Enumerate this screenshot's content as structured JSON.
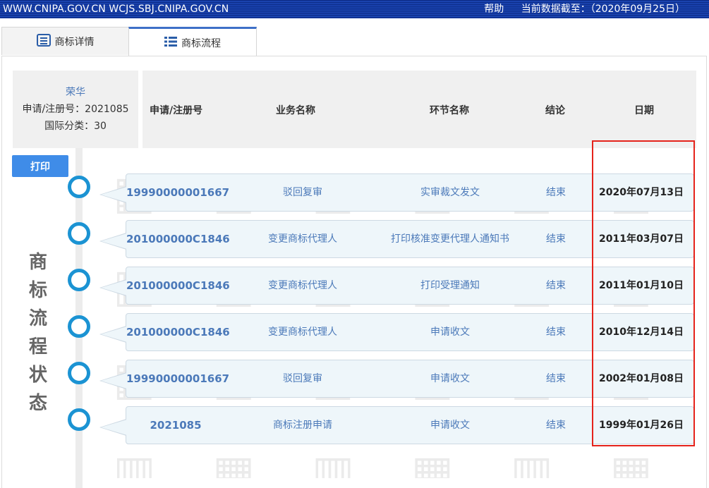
{
  "topbar": {
    "left_text": "WWW.CNIPA.GOV.CN WCJS.SBJ.CNIPA.GOV.CN",
    "help": "帮助",
    "data_as_of": "当前数据截至：（2020年09月25日）"
  },
  "tabs": [
    {
      "label": "商标详情",
      "icon": "document-icon",
      "active": false
    },
    {
      "label": "商标流程",
      "icon": "list-icon",
      "active": true
    }
  ],
  "info": {
    "name": "荣华",
    "reg_no_line": "申请/注册号：2021085",
    "class_line": "国际分类：30"
  },
  "print_button": "打印",
  "status_label": [
    "商",
    "标",
    "流",
    "程",
    "状",
    "态"
  ],
  "table": {
    "headers": [
      "申请/注册号",
      "业务名称",
      "环节名称",
      "结论",
      "日期"
    ],
    "rows": [
      {
        "number": "19990000001667",
        "business": "驳回复审",
        "step": "实审裁文发文",
        "result": "结束",
        "date": "2020年07月13日"
      },
      {
        "number": "201000000C1846",
        "business": "变更商标代理人",
        "step": "打印核准变更代理人通知书",
        "result": "结束",
        "date": "2011年03月07日"
      },
      {
        "number": "201000000C1846",
        "business": "变更商标代理人",
        "step": "打印受理通知",
        "result": "结束",
        "date": "2011年01月10日"
      },
      {
        "number": "201000000C1846",
        "business": "变更商标代理人",
        "step": "申请收文",
        "result": "结束",
        "date": "2010年12月14日"
      },
      {
        "number": "19990000001667",
        "business": "驳回复审",
        "step": "申请收文",
        "result": "结束",
        "date": "2002年01月08日"
      },
      {
        "number": "2021085",
        "business": "商标注册申请",
        "step": "申请收文",
        "result": "结束",
        "date": "1999年01月26日"
      }
    ]
  },
  "colors": {
    "topbar": "#1d48b8",
    "accent_blue": "#4b79b9",
    "timeline_circle": "#1b93d3",
    "print_button": "#3f8ce8",
    "highlight_box": "#e5231b"
  }
}
